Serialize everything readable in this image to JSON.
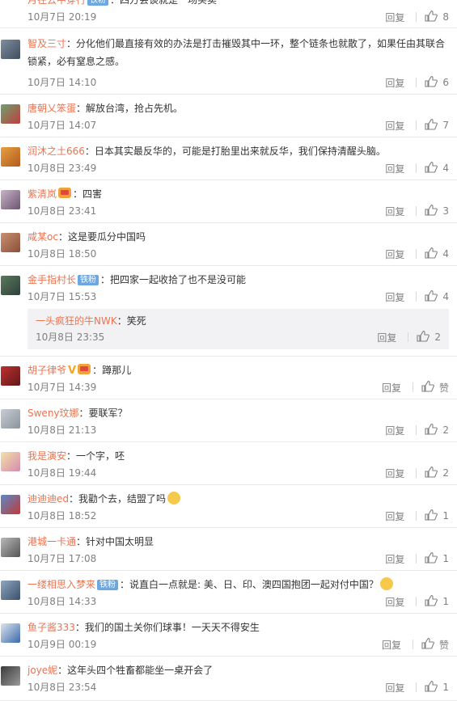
{
  "comments": [
    {
      "user": "月在云中穿行",
      "badge": "铁粉",
      "text": "：四方会谈就是一场买卖",
      "time": "10月7日 20:19",
      "reply": "回复",
      "likes": "8"
    },
    {
      "user": "智及三寸",
      "text": "：分化他们最直接有效的办法是打击摧毁其中一环，整个链条也就散了，如果任由其联合锁紧，必有窒息之感。",
      "time": "10月7日 14:10",
      "reply": "回复",
      "likes": "6"
    },
    {
      "user": "唐朝乂笨蛋",
      "text": "：解放台湾，抢占先机。",
      "time": "10月7日 14:07",
      "reply": "回复",
      "likes": "7"
    },
    {
      "user": "润沐之土666",
      "text": "：日本其实最反华的，可能是打胎里出来就反华，我们保持清醒头脑。",
      "time": "10月8日 23:49",
      "reply": "回复",
      "likes": "4"
    },
    {
      "user": "紫清岚",
      "text": "：四害",
      "time": "10月8日 23:41",
      "reply": "回复",
      "likes": "3"
    },
    {
      "user": "咸某oc",
      "text": "：这是要瓜分中国吗",
      "time": "10月8日 18:50",
      "reply": "回复",
      "likes": "4"
    },
    {
      "user": "金手指村长",
      "badge": "铁粉",
      "text": "：把四家一起收拾了也不是没可能",
      "time": "10月7日 15:53",
      "reply": "回复",
      "likes": "4",
      "sub": {
        "user": "一头疯狂的牛NWK",
        "text": "：笑死",
        "time": "10月8日 23:35",
        "reply": "回复",
        "likes": "2"
      }
    },
    {
      "user": "胡子律爷",
      "text": "：蹲那儿",
      "time": "10月7日 14:39",
      "reply": "回复",
      "likes": "赞"
    },
    {
      "user": "Sweny玟娜",
      "text": "：要联军？",
      "time": "10月8日 21:13",
      "reply": "回复",
      "likes": "2"
    },
    {
      "user": "我是演安",
      "text": "：一个字，呸",
      "time": "10月8日 19:44",
      "reply": "回复",
      "likes": "2"
    },
    {
      "user": "迪迪迪ed",
      "text": "：我勸个去，结盟了吗",
      "time": "10月8日 18:52",
      "reply": "回复",
      "likes": "1"
    },
    {
      "user": "港城一卡通",
      "text": "：针对中国太明显",
      "time": "10月7日 17:08",
      "reply": "回复",
      "likes": "1"
    },
    {
      "user": "一缕相思入梦来",
      "badge": "铁粉",
      "text": "：说直白一点就是: 美、日、印、澳四国抱团一起对付中国？",
      "time": "10月8日 14:33",
      "reply": "回复",
      "likes": "1"
    },
    {
      "user": "鱼子酱333",
      "text": "：我们的国土关你们球事！一天天不得安生",
      "time": "10月9日 00:19",
      "reply": "回复",
      "likes": "赞"
    },
    {
      "user": "joye妮",
      "text": "：这年头四个牲畜都能坐一桌开会了",
      "time": "10月8日 23:54",
      "reply": "回复",
      "likes": "1"
    }
  ],
  "colors": {
    "username": "#eb7350",
    "meta": "#808080",
    "text": "#333333",
    "sub_bg": "#f2f2f5",
    "badge": "#6ca7e0"
  }
}
